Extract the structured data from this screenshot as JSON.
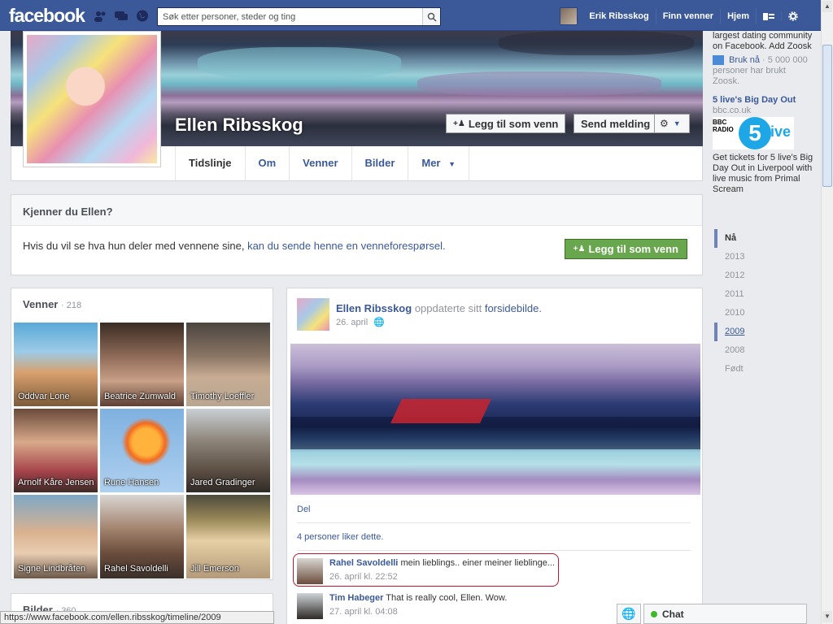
{
  "topbar": {
    "logo": "facebook",
    "search_placeholder": "Søk etter personer, steder og ting",
    "user_name": "Erik Ribsskog",
    "find_friends": "Finn venner",
    "home": "Hjem"
  },
  "profile": {
    "name": "Ellen Ribsskog",
    "add_friend": "Legg til som venn",
    "send_message": "Send melding",
    "tabs": [
      "Tidslinje",
      "Om",
      "Venner",
      "Bilder",
      "Mer"
    ]
  },
  "know": {
    "title": "Kjenner du Ellen?",
    "text": "Hvis du vil se hva hun deler med vennene sine,",
    "link": "kan du sende henne en venneforespørsel.",
    "button": "Legg til som venn"
  },
  "friends": {
    "title": "Venner",
    "count": "· 218",
    "items": [
      {
        "name": "Oddvar Lone"
      },
      {
        "name": "Beatrice Zumwald"
      },
      {
        "name": "Timothy Loeffler"
      },
      {
        "name": "Arnolf Kåre Jensen"
      },
      {
        "name": "Rune Hansen"
      },
      {
        "name": "Jared Gradinger"
      },
      {
        "name": "Signe Lindbråten"
      },
      {
        "name": "Rahel Savoldelli"
      },
      {
        "name": "Jill Emerson"
      }
    ]
  },
  "photos": {
    "title": "Bilder",
    "count": "· 360"
  },
  "post": {
    "author": "Ellen Ribsskog",
    "action": "oppdaterte sitt",
    "object": "forsidebilde.",
    "date": "26. april",
    "share": "Del",
    "likes": "4 personer liker dette.",
    "comments": [
      {
        "name": "Rahel Savoldelli",
        "text": "mein lieblings.. einer meiner lieblinge...",
        "time": "26. april kl. 22:52"
      },
      {
        "name": "Tim Habeger",
        "text": "That is really cool, Ellen. Wow.",
        "time": "27. april kl. 04:08"
      }
    ]
  },
  "sidebar": {
    "ad1_text": "largest dating community on Facebook. Add Zoosk",
    "ad1_action": "Bruk nå",
    "ad1_social": "· 5 000 000 personer har brukt Zoosk.",
    "ad2_title": "5 live's Big Day Out",
    "ad2_url": "bbc.co.uk",
    "ad2_logo_bbc": "BBC RADIO",
    "ad2_logo_5": "5",
    "ad2_logo_live": "live",
    "ad2_text": "Get tickets for 5 live's Big Day Out in Liverpool with live music from Primal Scream",
    "timeline": [
      "Nå",
      "2013",
      "2012",
      "2011",
      "2010",
      "2009",
      "2008",
      "Født"
    ]
  },
  "status_url": "https://www.facebook.com/ellen.ribsskog/timeline/2009",
  "chat_label": "Chat"
}
